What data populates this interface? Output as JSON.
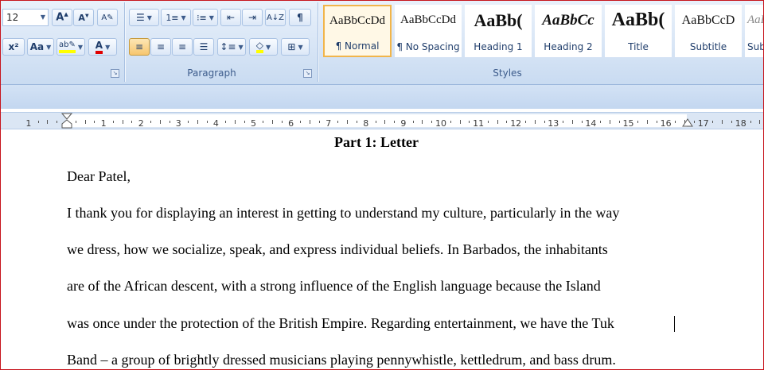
{
  "font": {
    "size_value": "12"
  },
  "paragraph_group": {
    "label": "Paragraph"
  },
  "styles_group": {
    "label": "Styles",
    "items": [
      {
        "sample": "AaBbCcDd",
        "name": "¶ Normal"
      },
      {
        "sample": "AaBbCcDd",
        "name": "¶ No Spacing"
      },
      {
        "sample": "AaBb(",
        "name": "Heading 1"
      },
      {
        "sample": "AaBbCc",
        "name": "Heading 2"
      },
      {
        "sample": "AaBb(",
        "name": "Title"
      },
      {
        "sample": "AaBbCcD",
        "name": "Subtitle"
      },
      {
        "sample": "AaB",
        "name": "Sub"
      }
    ]
  },
  "ruler": {
    "numbers": [
      "1",
      "1",
      "2",
      "3",
      "4",
      "5",
      "6",
      "7",
      "8",
      "9",
      "10",
      "11",
      "12",
      "13",
      "14",
      "15",
      "16",
      "17",
      "18"
    ]
  },
  "document": {
    "heading": "Part 1: Letter",
    "lines": [
      "Dear Patel,",
      "I thank you for displaying an interest in getting to understand my culture, particularly in the way",
      "we dress, how we socialize, speak, and express individual beliefs. In Barbados, the inhabitants",
      "are of the African descent, with a strong influence of the English language because the Island",
      "was once under the protection of the British Empire. Regarding entertainment, we have the Tuk",
      "Band – a group of brightly dressed musicians playing pennywhistle, kettledrum, and bass drum."
    ]
  },
  "colors": {
    "frame_border": "#c7141c",
    "highlight_yellow": "#ffff00",
    "font_color_red": "#e00000",
    "selected_style_border": "#f1b54b"
  }
}
